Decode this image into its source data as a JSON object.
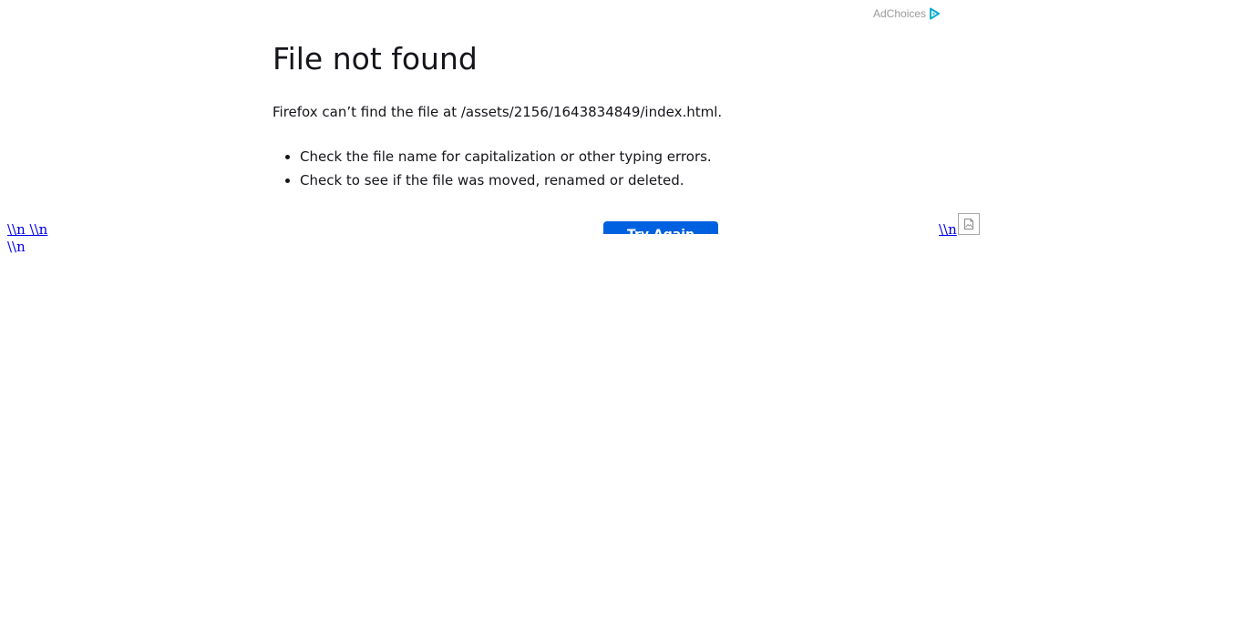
{
  "ad": {
    "adchoices_label": "AdChoices",
    "adchoices_icon": "adchoices-triangle-icon",
    "accent": "#00aecd"
  },
  "error": {
    "title": "File not found",
    "description": "Firefox can’t find the file at /assets/2156/1643834849/index.html.",
    "hints": [
      "Check the file name for capitalization or other typing errors.",
      "Check to see if the file was moved, renamed or deleted."
    ],
    "button_label": "Try Again",
    "button_color": "#0061e0"
  },
  "links": {
    "left_line1": "\\\\n \\\\n ",
    "left_line2": "\\\\n",
    "right": "\\\\n"
  },
  "broken_image_icon": "broken-image-icon"
}
